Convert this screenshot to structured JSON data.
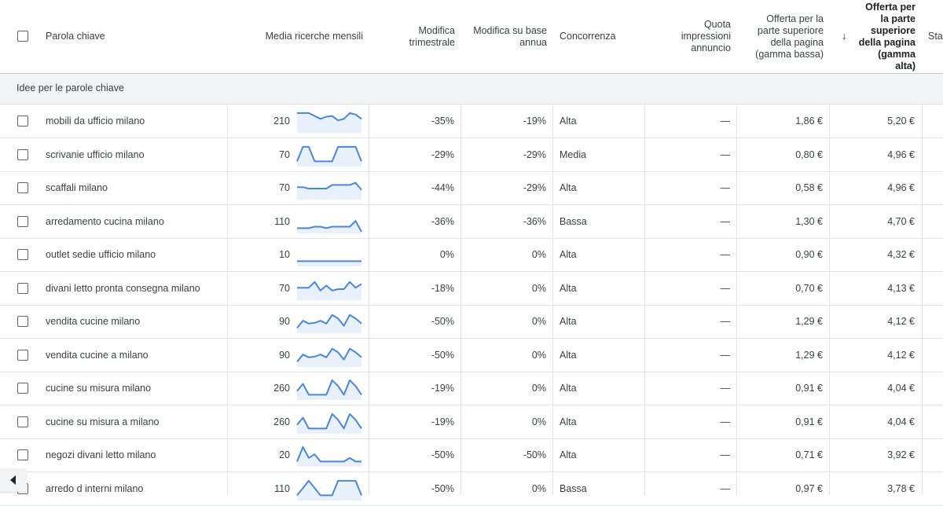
{
  "columns": {
    "keyword": "Parola chiave",
    "searches": "Media ricerche mensili",
    "qchange": "Modifica trimestrale",
    "ychange": "Modifica su base annua",
    "competition": "Concorrenza",
    "impr_share": "Quota impressioni annuncio",
    "bid_low": "Offerta per la parte superiore della pagina (gamma bassa)",
    "bid_high": "Offerta per la parte superiore della pagina (gamma alta)",
    "status": "Sta",
    "sort_indicator": "↓"
  },
  "group_label": "Idee per le parole chiave",
  "colors": {
    "spark_line": "#4a86d9",
    "spark_fill": "#e8f0fc"
  },
  "rows": [
    {
      "keyword": "mobili da ufficio milano",
      "searches": "210",
      "trend": [
        3,
        3,
        3,
        2.6,
        2.2,
        2.5,
        2.6,
        2,
        2.2,
        3,
        2.8,
        2.2
      ],
      "qchange": "-35%",
      "ychange": "-19%",
      "competition": "Alta",
      "impr_share": "—",
      "bid_low": "1,86 €",
      "bid_high": "5,20 €"
    },
    {
      "keyword": "scrivanie ufficio milano",
      "searches": "70",
      "trend": [
        1,
        3,
        3,
        1,
        1,
        1,
        1,
        3,
        3,
        3,
        3,
        1
      ],
      "qchange": "-29%",
      "ychange": "-29%",
      "competition": "Media",
      "impr_share": "—",
      "bid_low": "0,80 €",
      "bid_high": "4,96 €"
    },
    {
      "keyword": "scaffali milano",
      "searches": "70",
      "trend": [
        2,
        2,
        1.8,
        1.8,
        1.8,
        1.8,
        2.3,
        2.3,
        2.3,
        2.3,
        2.6,
        1.6
      ],
      "qchange": "-44%",
      "ychange": "-29%",
      "competition": "Alta",
      "impr_share": "—",
      "bid_low": "0,58 €",
      "bid_high": "4,96 €"
    },
    {
      "keyword": "arredamento cucina milano",
      "searches": "110",
      "trend": [
        1,
        1,
        1,
        1.2,
        1.2,
        1,
        1.2,
        1.2,
        1.2,
        1.2,
        2,
        0.5
      ],
      "qchange": "-36%",
      "ychange": "-36%",
      "competition": "Bassa",
      "impr_share": "—",
      "bid_low": "1,30 €",
      "bid_high": "4,70 €"
    },
    {
      "keyword": "outlet sedie ufficio milano",
      "searches": "10",
      "trend": [
        1,
        1,
        1,
        1,
        1,
        1,
        1,
        1,
        1,
        1,
        1,
        1
      ],
      "qchange": "0%",
      "ychange": "0%",
      "competition": "Alta",
      "impr_share": "—",
      "bid_low": "0,90 €",
      "bid_high": "4,32 €"
    },
    {
      "keyword": "divani letto pronta consegna milano",
      "searches": "70",
      "trend": [
        2,
        2,
        2,
        2.8,
        1.6,
        2.3,
        1.6,
        1.8,
        1.8,
        2.8,
        2,
        2.5
      ],
      "qchange": "-18%",
      "ychange": "0%",
      "competition": "Alta",
      "impr_share": "—",
      "bid_low": "0,70 €",
      "bid_high": "4,13 €"
    },
    {
      "keyword": "vendita cucine milano",
      "searches": "90",
      "trend": [
        1,
        2,
        1.6,
        1.7,
        2,
        1.6,
        2.8,
        2.3,
        1.3,
        2.8,
        2.3,
        1.6
      ],
      "qchange": "-50%",
      "ychange": "0%",
      "competition": "Alta",
      "impr_share": "—",
      "bid_low": "1,29 €",
      "bid_high": "4,12 €"
    },
    {
      "keyword": "vendita cucine a milano",
      "searches": "90",
      "trend": [
        1,
        2,
        1.6,
        1.7,
        2,
        1.6,
        2.8,
        2.3,
        1.3,
        2.8,
        2.3,
        1.6
      ],
      "qchange": "-50%",
      "ychange": "0%",
      "competition": "Alta",
      "impr_share": "—",
      "bid_low": "1,29 €",
      "bid_high": "4,12 €"
    },
    {
      "keyword": "cucine su misura milano",
      "searches": "260",
      "trend": [
        1.5,
        2.5,
        1,
        1,
        1,
        1,
        3,
        2.2,
        1,
        3,
        2.2,
        1
      ],
      "qchange": "-19%",
      "ychange": "0%",
      "competition": "Alta",
      "impr_share": "—",
      "bid_low": "0,91 €",
      "bid_high": "4,04 €"
    },
    {
      "keyword": "cucine su misura a milano",
      "searches": "260",
      "trend": [
        1.5,
        2.5,
        1,
        1,
        1,
        1,
        3,
        2.2,
        1,
        3,
        2.2,
        1
      ],
      "qchange": "-19%",
      "ychange": "0%",
      "competition": "Alta",
      "impr_share": "—",
      "bid_low": "0,91 €",
      "bid_high": "4,04 €"
    },
    {
      "keyword": "negozi divani letto milano",
      "searches": "20",
      "trend": [
        1,
        3,
        1.5,
        2,
        1,
        1,
        1,
        1,
        1,
        1.5,
        1,
        1
      ],
      "qchange": "-50%",
      "ychange": "-50%",
      "competition": "Alta",
      "impr_share": "—",
      "bid_low": "0,71 €",
      "bid_high": "3,92 €"
    },
    {
      "keyword": "arredo d interni milano",
      "searches": "110",
      "trend": [
        1,
        2,
        3,
        2,
        1,
        1,
        1,
        3,
        3,
        3,
        3,
        1
      ],
      "qchange": "-50%",
      "ychange": "0%",
      "competition": "Bassa",
      "impr_share": "—",
      "bid_low": "0,97 €",
      "bid_high": "3,78 €"
    }
  ]
}
